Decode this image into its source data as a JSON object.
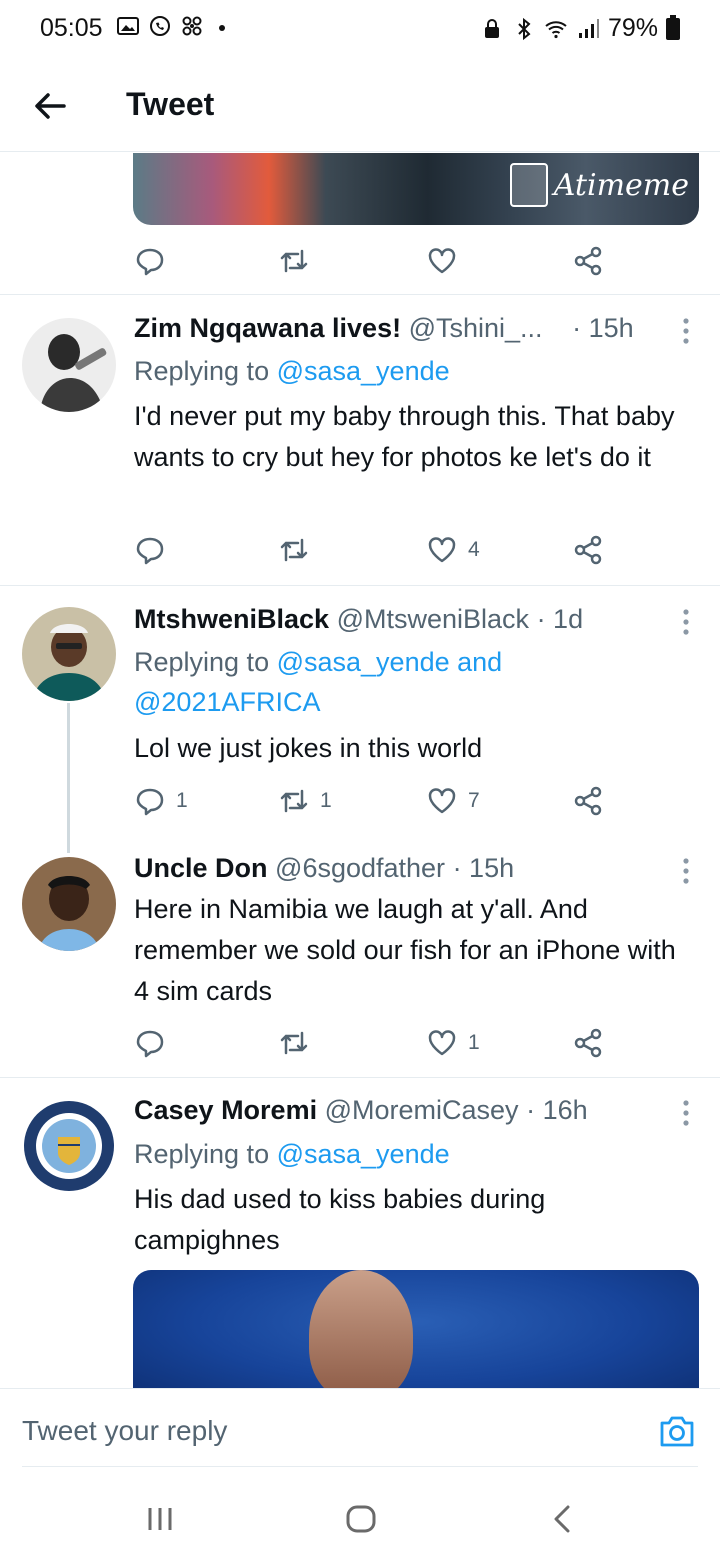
{
  "status_bar": {
    "time": "05:05",
    "battery": "79%",
    "left_icons": [
      "gallery-icon",
      "whatsapp-icon",
      "fan-icon",
      "dot-icon"
    ],
    "right_icons": [
      "lock-icon",
      "bluetooth-icon",
      "wifi-icon",
      "signal-icon",
      "battery-icon"
    ]
  },
  "header": {
    "title": "Tweet"
  },
  "top_tweet": {
    "watermark": "Atimeme",
    "actions": {
      "reply": "",
      "retweet": "",
      "like": "",
      "share": ""
    }
  },
  "replies": [
    {
      "name": "Zim Ngqawana lives!",
      "handle": "@Tshini_...",
      "time": "· 15h",
      "replying_prefix": "Replying to ",
      "replying_to": "@sasa_yende",
      "replying_to_2": "",
      "text": "I'd never put my baby through this. That baby wants to cry but hey for photos ke let's do it",
      "counts": {
        "reply": "",
        "retweet": "",
        "like": "4"
      }
    },
    {
      "name": "MtshweniBlack",
      "handle": "@MtsweniBlack",
      "time": "· 1d",
      "replying_prefix": "Replying to ",
      "replying_to": "@sasa_yende and",
      "replying_to_2": "@2021AFRICA",
      "text": "Lol we just jokes in this world",
      "counts": {
        "reply": "1",
        "retweet": "1",
        "like": "7"
      }
    },
    {
      "name": "Uncle Don",
      "handle": "@6sgodfather",
      "time": "· 15h",
      "text": "Here in Namibia we laugh at y'all.  And remember we sold our fish for an iPhone with 4 sim cards",
      "counts": {
        "reply": "",
        "retweet": "",
        "like": "1"
      }
    },
    {
      "name": "Casey Moremi",
      "handle": "@MoremiCasey",
      "time": "· 16h",
      "replying_prefix": "Replying to ",
      "replying_to": "@sasa_yende",
      "text": "His dad used to kiss babies during campighnes",
      "avatar_text": "MANCHESTER CITY"
    }
  ],
  "reply_bar": {
    "placeholder": "Tweet your reply"
  },
  "colors": {
    "link": "#1d9bf0",
    "muted": "#536471",
    "text": "#0f1419",
    "divider": "#e6ecf0"
  }
}
